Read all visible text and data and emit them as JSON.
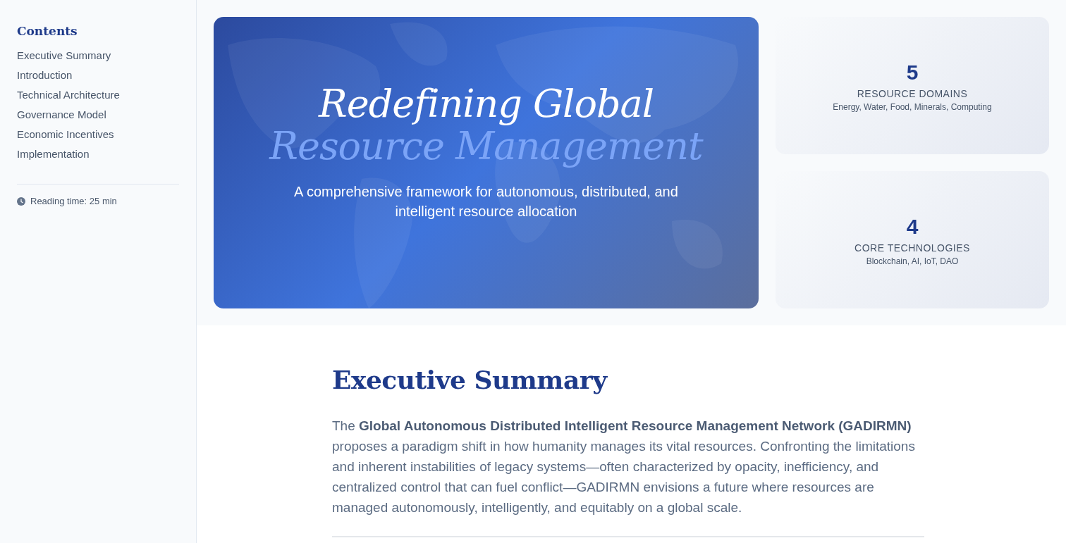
{
  "sidebar": {
    "title": "Contents",
    "items": [
      {
        "label": "Executive Summary"
      },
      {
        "label": "Introduction"
      },
      {
        "label": "Technical Architecture"
      },
      {
        "label": "Governance Model"
      },
      {
        "label": "Economic Incentives"
      },
      {
        "label": "Implementation"
      }
    ],
    "reading_time": "Reading time: 25 min"
  },
  "hero": {
    "title": "Redefining Global",
    "title_accent": "Resource Management",
    "subtitle": "A comprehensive framework for autonomous, distributed, and intelligent resource allocation"
  },
  "stats": [
    {
      "value": "5",
      "label": "RESOURCE DOMAINS",
      "detail": "Energy, Water, Food, Minerals, Computing"
    },
    {
      "value": "4",
      "label": "CORE TECHNOLOGIES",
      "detail": "Blockchain, AI, IoT, DAO"
    }
  ],
  "section": {
    "heading": "Executive Summary",
    "paragraph": "The **Global Autonomous Distributed Intelligent Resource Management Network (GADIRMN)** proposes a paradigm shift in how humanity manages its vital resources. Confronting the limitations and inherent instabilities of legacy systems—often characterized by opacity, inefficiency, and centralized control that can fuel conflict—GADIRMN envisions a future where resources are managed autonomously, intelligently, and equitably on a global scale."
  }
}
